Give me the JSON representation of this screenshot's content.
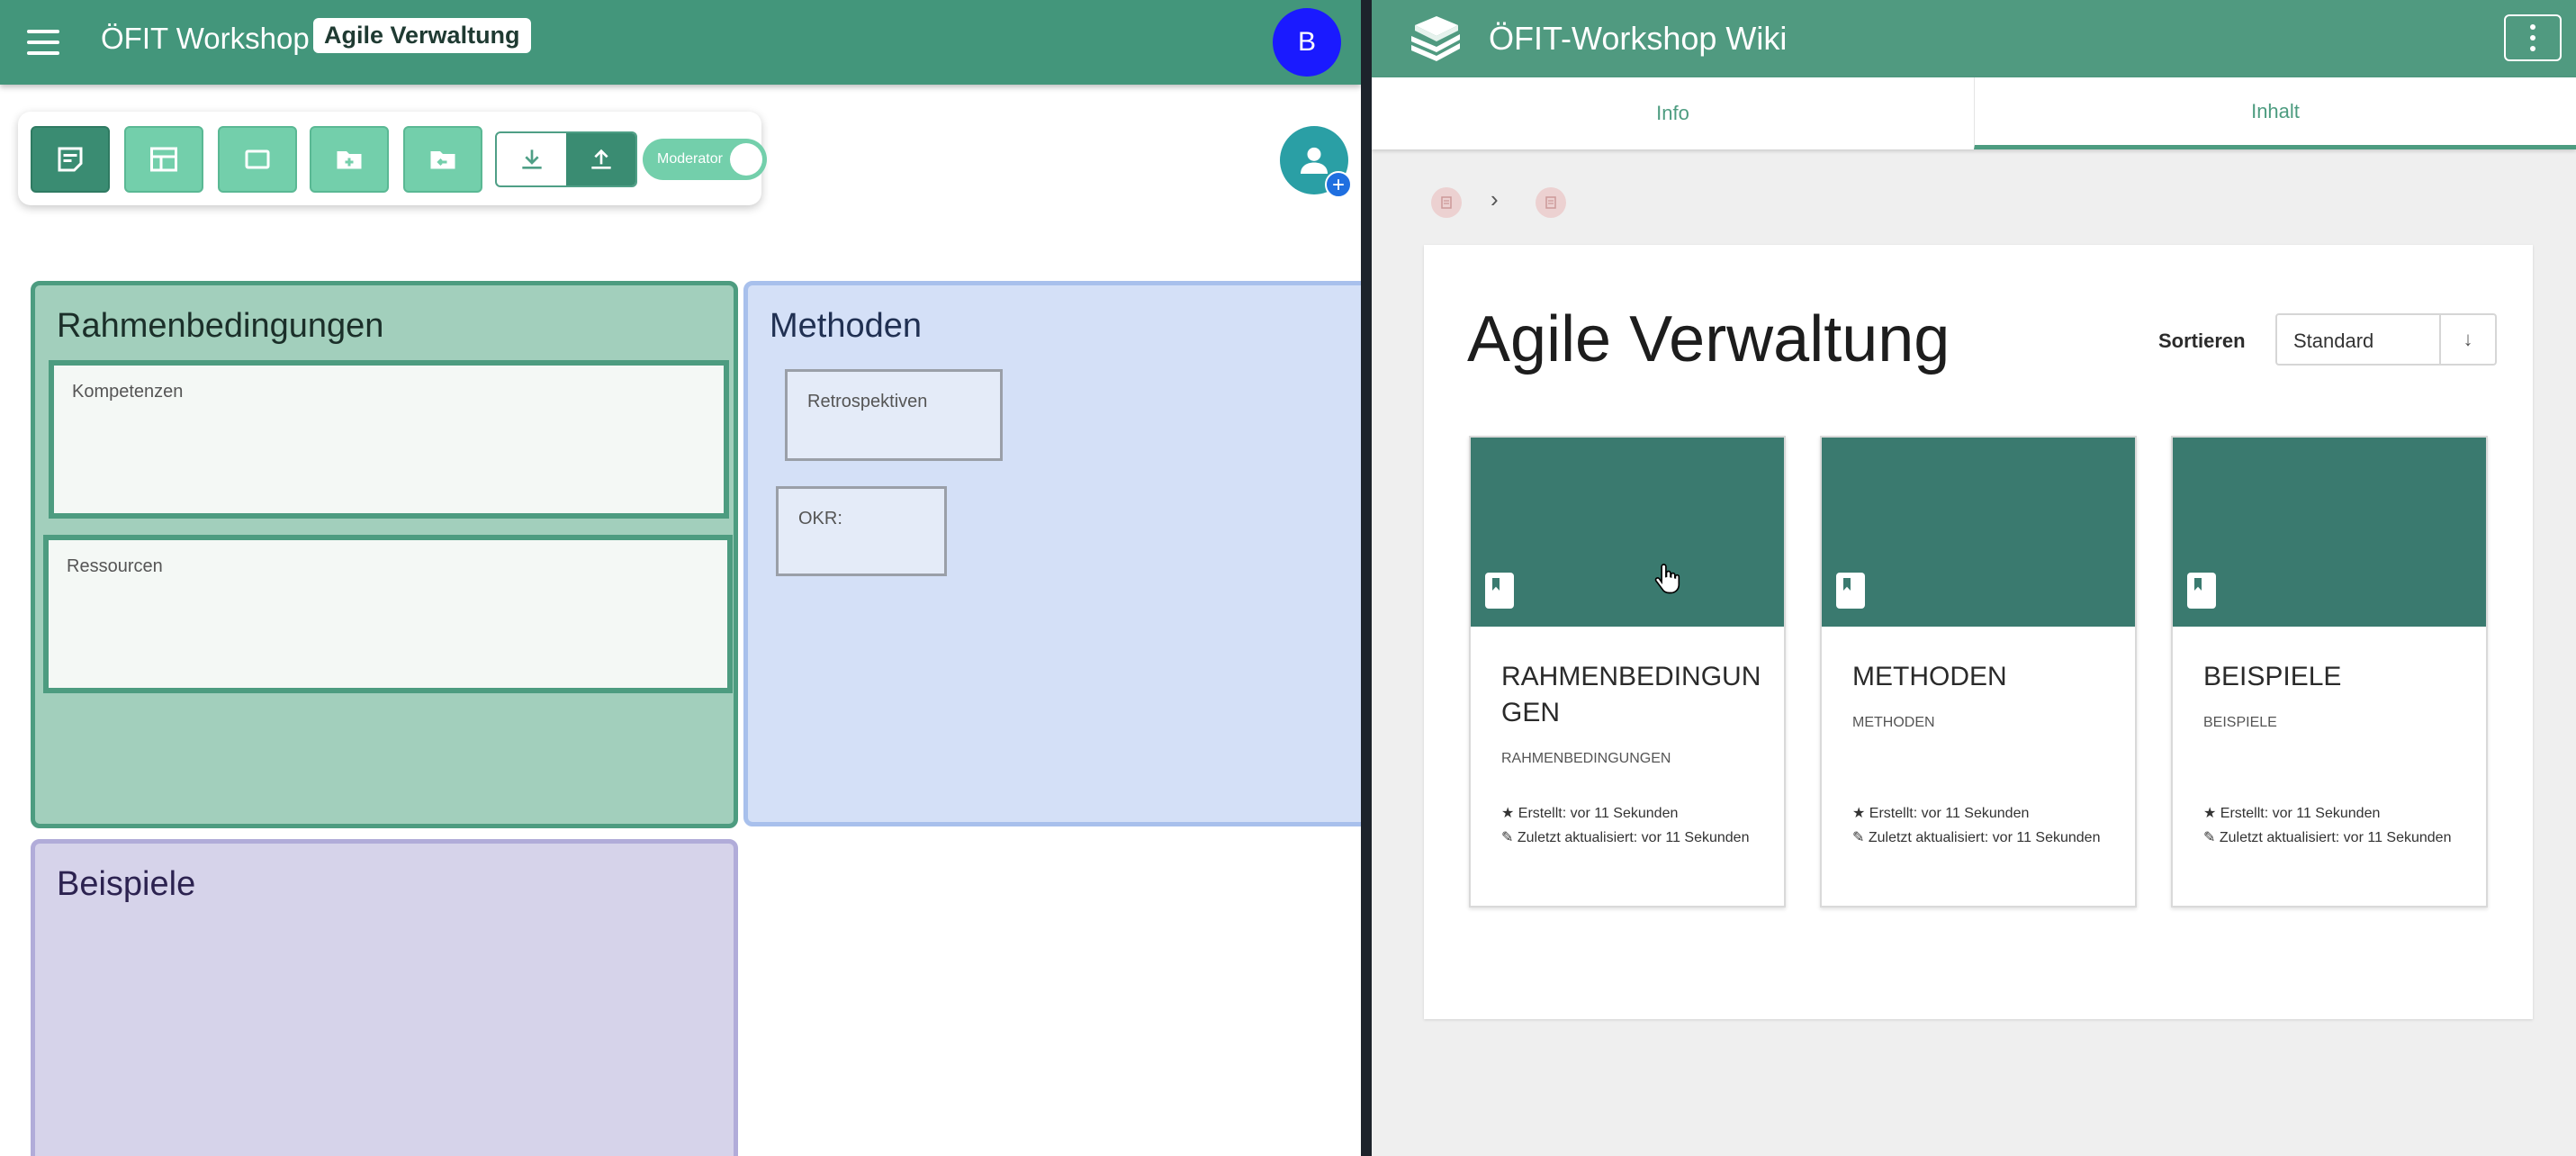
{
  "left_app": {
    "title": "ÖFIT Workshop",
    "board_name": "Agile Verwaltung",
    "user_initial": "B",
    "moderator_label": "Moderator",
    "frames": {
      "rahmen": {
        "title": "Rahmenbedingungen",
        "notes": [
          "Kompetenzen",
          "Ressourcen"
        ]
      },
      "methoden": {
        "title": "Methoden",
        "notes": [
          "Retrospektiven",
          "OKR:"
        ]
      },
      "beispiele": {
        "title": "Beispiele"
      }
    }
  },
  "wiki": {
    "title": "ÖFIT-Workshop Wiki",
    "tabs": [
      "Info",
      "Inhalt"
    ],
    "active_tab": "Inhalt",
    "page_title": "Agile Verwaltung",
    "sort_label": "Sortieren",
    "sort_value": "Standard",
    "sort_arrow": "↓",
    "cards": [
      {
        "title": "RAHMENBEDINGUNGEN",
        "subtitle": "RAHMENBEDINGUNGEN",
        "created": "★ Erstellt: vor 11 Sekunden",
        "updated": "✎ Zuletzt aktualisiert: vor 11 Sekunden"
      },
      {
        "title": "METHODEN",
        "subtitle": "METHODEN",
        "created": "★ Erstellt: vor 11 Sekunden",
        "updated": "✎ Zuletzt aktualisiert: vor 11 Sekunden"
      },
      {
        "title": "BEISPIELE",
        "subtitle": "BEISPIELE",
        "created": "★ Erstellt: vor 11 Sekunden",
        "updated": "✎ Zuletzt aktualisiert: vor 11 Sekunden"
      }
    ]
  },
  "colors": {
    "header_green": "#43967b",
    "wiki_green": "#509a80",
    "card_banner": "#3a7a6f",
    "frame_green": "#a2cfbc",
    "frame_blue": "#d4e0f7",
    "frame_purple": "#d6d3ea",
    "user_blue": "#1a1aff"
  }
}
